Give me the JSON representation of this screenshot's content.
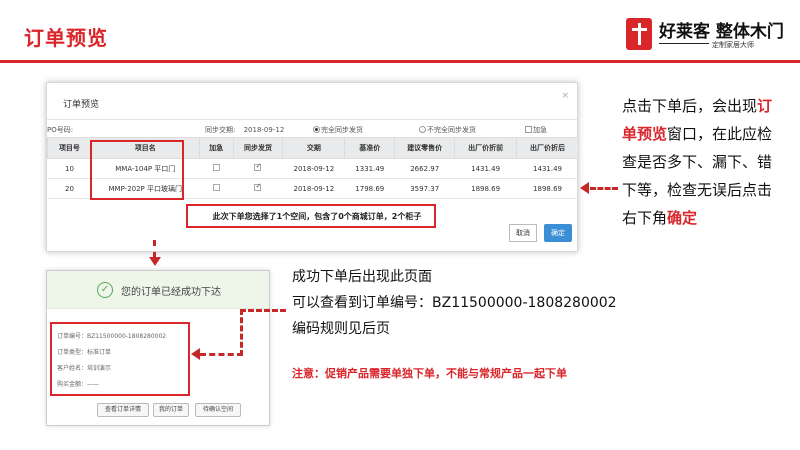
{
  "slide": {
    "title": "订单预览",
    "logo_name": "好莱客 整体木门",
    "logo_slogan": "定制家居大师"
  },
  "dialog": {
    "title": "订单预览",
    "close": "×",
    "po_label": "PO号码:",
    "sync_date_label": "同步交期:",
    "sync_date_value": "2018-09-12",
    "opt_full_sync": "完全同步发货",
    "opt_partial_sync": "不完全同步发货",
    "opt_urgent": "加急",
    "headers": [
      "项目号",
      "项目名",
      "加急",
      "同步发货",
      "交期",
      "基准价",
      "建议零售价",
      "出厂价折前",
      "出厂价折后"
    ],
    "rows": [
      {
        "no": "10",
        "name": "MMA-104P 平口门",
        "urgent": false,
        "sync": true,
        "date": "2018-09-12",
        "base": "1331.49",
        "retail": "2662.97",
        "pre": "1431.49",
        "post": "1431.49"
      },
      {
        "no": "20",
        "name": "MMP-202P 平口玻璃门",
        "urgent": false,
        "sync": true,
        "date": "2018-09-12",
        "base": "1798.69",
        "retail": "3597.37",
        "pre": "1898.69",
        "post": "1898.69"
      }
    ],
    "summary": "此次下单您选择了1个空间，包含了0个商城订单，2个柜子",
    "cancel": "取消",
    "confirm": "确定"
  },
  "success": {
    "message": "您的订单已经成功下达",
    "order_no": "订单编号：BZ11500000-1808280002",
    "order_type": "订单类型：标准订单",
    "customer": "客户姓名：培训演示",
    "amount": "购买金额：——",
    "btn_detail": "查看订单详情",
    "btn_my_orders": "我的订单",
    "btn_pending": "待确认空间"
  },
  "notes": {
    "right_1": "点击下单后，会出现",
    "right_em1": "订单预览",
    "right_2": "窗口，在此应检查是否多下、漏下、错下等，检查无误后点击右下角",
    "right_em2": "确定",
    "line_a": "成功下单后出现此页面",
    "line_b": "可以查看到订单编号：BZ11500000-1808280002",
    "line_c": "编码规则见后页",
    "warning": "注意：促销产品需要单独下单，不能与常规产品一起下单"
  },
  "colors": {
    "accent": "#d9262b",
    "primary_button": "#3a8fd6",
    "success_bg": "#eef6ea"
  }
}
